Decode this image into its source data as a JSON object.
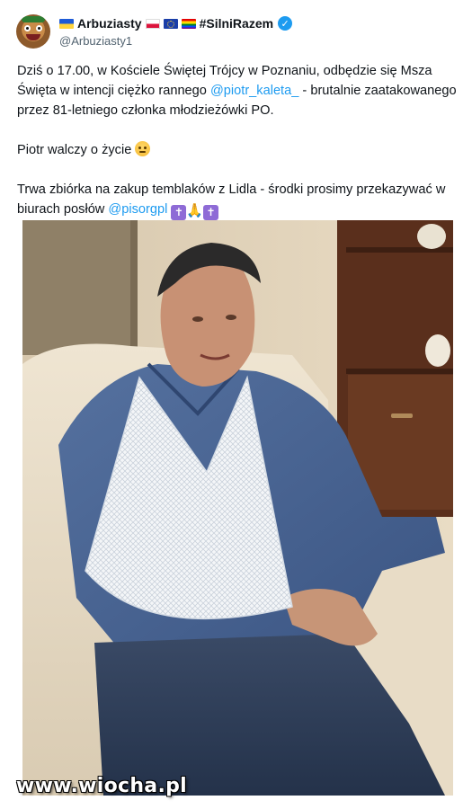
{
  "post": {
    "display_name": "Arbuziasty",
    "hashtag": "#SilniRazem",
    "handle": "@Arbuziasty1",
    "p1_before": "Dziś o 17.00, w Kościele Świętej Trójcy w Poznaniu, odbędzie się Msza Święta w intencji ciężko rannego ",
    "p1_mention": "@piotr_kaleta_",
    "p1_after": " - brutalnie zaatakowanego przez 81-letniego członka młodzieżówki PO.",
    "p2": "Piotr walczy o życie",
    "p3_before": "Trwa zbiórka na zakup temblaków z Lidla - środki prosimy przekazywać w biurach posłów ",
    "p3_mention": "@pisorgpl",
    "cross_glyph": "✝"
  },
  "icons": {
    "avatar": "avatar-icon",
    "flags": [
      "ukraine-flag-icon",
      "poland-flag-icon",
      "eu-flag-icon",
      "rainbow-flag-icon"
    ],
    "verified": "verified-badge-icon",
    "emoji": [
      "pleading-face-icon",
      "cross-icon",
      "praying-hands-icon",
      "cross-icon"
    ]
  },
  "colors": {
    "link": "#1d9bf0",
    "text": "#0f1419",
    "secondary_text": "#536471",
    "verified": "#1d9bf0"
  },
  "media": {
    "watermark": "www.wiocha.pl"
  }
}
